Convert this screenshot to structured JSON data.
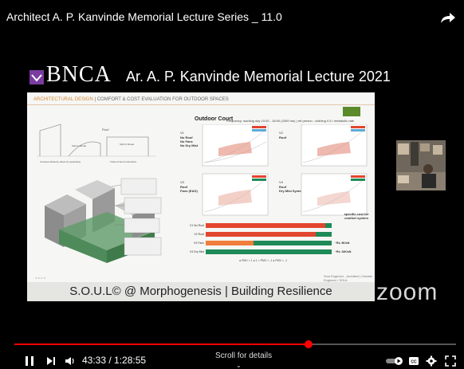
{
  "video": {
    "title": "Architect A. P. Kanvinde Memorial Lecture Series _ 11.0",
    "share_icon": "share-arrow-icon"
  },
  "slide_banner": {
    "org_name": "BNCA",
    "lecture_title": "Ar. A. P. Kanvinde Memorial Lecture 2021"
  },
  "slide": {
    "section_heading_accent": "ARCHITECTURAL DESIGN",
    "section_heading_rest": " | COMFORT & COST EVALUATION FOR OUTDOOR SPACES",
    "chart_title": "Outdoor Court",
    "chart_subtitle": "Frequency: working day 10:00 - 18:00 (2009 hrs) | ref person : clothing 0.5 / metabolic rate 1.2",
    "sketch_label_1": "Roof",
    "sketch_label_2": "Split & Shade",
    "sketch_label_3": "Split & Shade",
    "sketch_caption_left": "Increase Distance effect by separating with the semi-open building Cluster",
    "sketch_caption_right": "Voids at Semi-Interaction/Interactive",
    "chart_labels": [
      {
        "id": "q1",
        "lines": [
          "V1",
          "No Roof",
          "No Fans",
          "No Dry Mist"
        ]
      },
      {
        "id": "q2",
        "lines": [
          "V2",
          "Roof"
        ]
      },
      {
        "id": "q3",
        "lines": [
          "V3",
          "Roof",
          "Fans (EAG)"
        ]
      },
      {
        "id": "q4",
        "lines": [
          "V4",
          "Roof",
          "Dry Mist Systems"
        ]
      }
    ],
    "bars": [
      {
        "label": "V1 No Roof",
        "tail": ""
      },
      {
        "label": "V2 Roof",
        "tail": ""
      },
      {
        "label": "V3 Fans",
        "tail": "~Rs. 8K/sft."
      },
      {
        "label": "V4 Dry Mist",
        "tail": "~Rs. 34K/sft."
      }
    ],
    "specific_cost_note": "specific cost for comfort system",
    "legend_text": "● PMV > 1   ● 1 > PMV > -1   ● PMV < -1",
    "footer_credit": "Soul Engineer - Architect | Climate Engineer / SOUL"
  },
  "slide_bottom_bar": "S.O.U.L© @ Morphogenesis | Building Resilience",
  "zoom_logo": "zoom",
  "player": {
    "progress_fraction": 0.666,
    "current_time": "43:33 / 1:28:55",
    "scroll_hint": "Scroll for details",
    "buttons": [
      "pause-icon",
      "next-icon",
      "volume-icon",
      "autoplay-toggle-icon",
      "captions-icon",
      "settings-icon",
      "fullscreen-icon"
    ]
  },
  "colors": {
    "progress": "#ff0000",
    "bnca_purple": "#7a3ca0",
    "bar_red": "#e2462e",
    "bar_orange": "#ef7d3c",
    "bar_green": "#1e8a57",
    "slide_accent": "#d38a3a"
  }
}
